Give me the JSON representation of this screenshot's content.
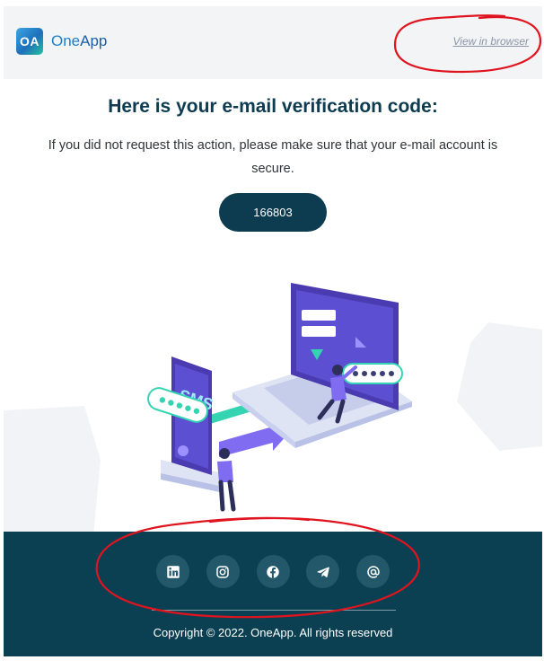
{
  "header": {
    "logo_mark": "OA",
    "logo_text_one": "One",
    "logo_text_app": "App",
    "view_in_browser": "View in browser"
  },
  "main": {
    "title": "Here is your e-mail verification code:",
    "subtitle": "If you did not request this action, please make sure that your e-mail account is secure.",
    "code": "166803",
    "illustration_sms_label": "SMS"
  },
  "footer": {
    "socials": [
      {
        "name": "linkedin-icon"
      },
      {
        "name": "instagram-icon"
      },
      {
        "name": "facebook-icon"
      },
      {
        "name": "telegram-icon"
      },
      {
        "name": "email-at-icon"
      }
    ],
    "copyright": "Copyright © 2022. OneApp. All rights reserved"
  },
  "colors": {
    "primary": "#0d3b50",
    "footer_bg": "#0b4053",
    "header_bg": "#f2f4f6",
    "annotation": "#e0141e"
  }
}
